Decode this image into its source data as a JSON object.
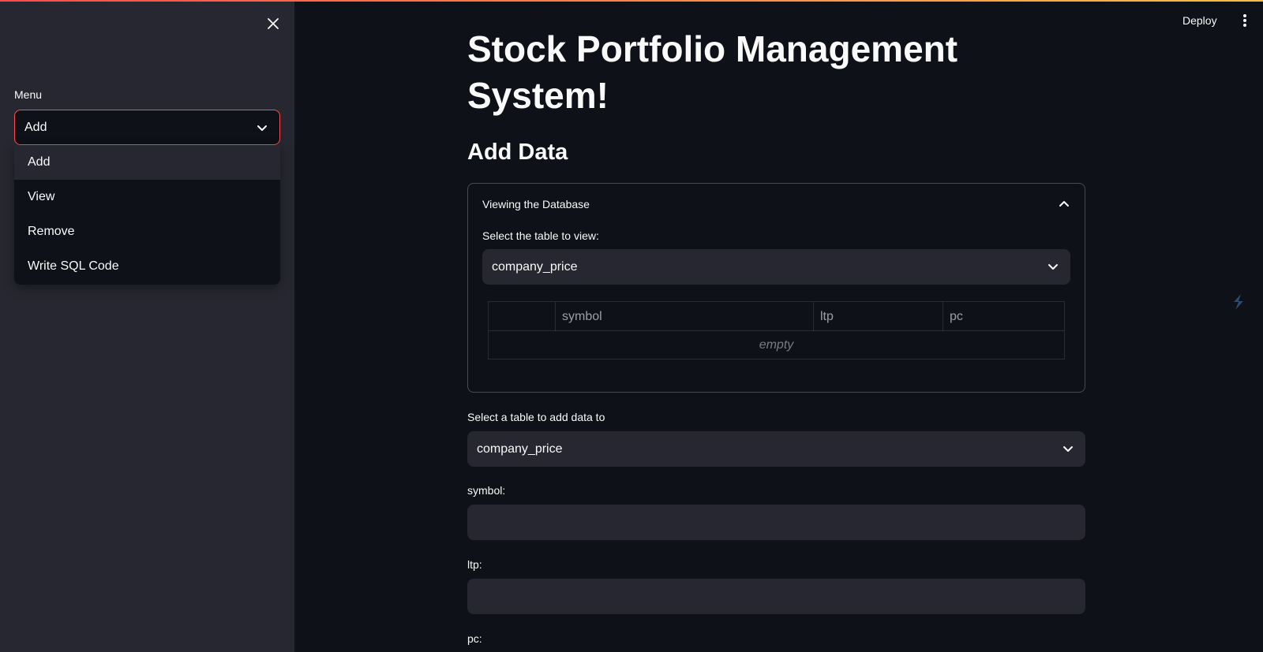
{
  "sidebar": {
    "menu_label": "Menu",
    "selected": "Add",
    "options": [
      "Add",
      "View",
      "Remove",
      "Write SQL Code"
    ]
  },
  "header": {
    "deploy_label": "Deploy"
  },
  "main": {
    "title": "Stock Portfolio Management System!",
    "subheader": "Add Data",
    "expander": {
      "title": "Viewing the Database",
      "select_label": "Select the table to view:",
      "selected_table": "company_price",
      "columns": [
        "",
        "symbol",
        "ltp",
        "pc"
      ],
      "empty_text": "empty"
    },
    "add_table_label": "Select a table to add data to",
    "add_table_value": "company_price",
    "fields": [
      {
        "label": "symbol:",
        "value": ""
      },
      {
        "label": "ltp:",
        "value": ""
      },
      {
        "label": "pc:",
        "value": ""
      }
    ]
  },
  "colors": {
    "background": "#0e1117",
    "sidebar": "#262730",
    "accent": "#ff4b4b",
    "input": "#262730"
  }
}
